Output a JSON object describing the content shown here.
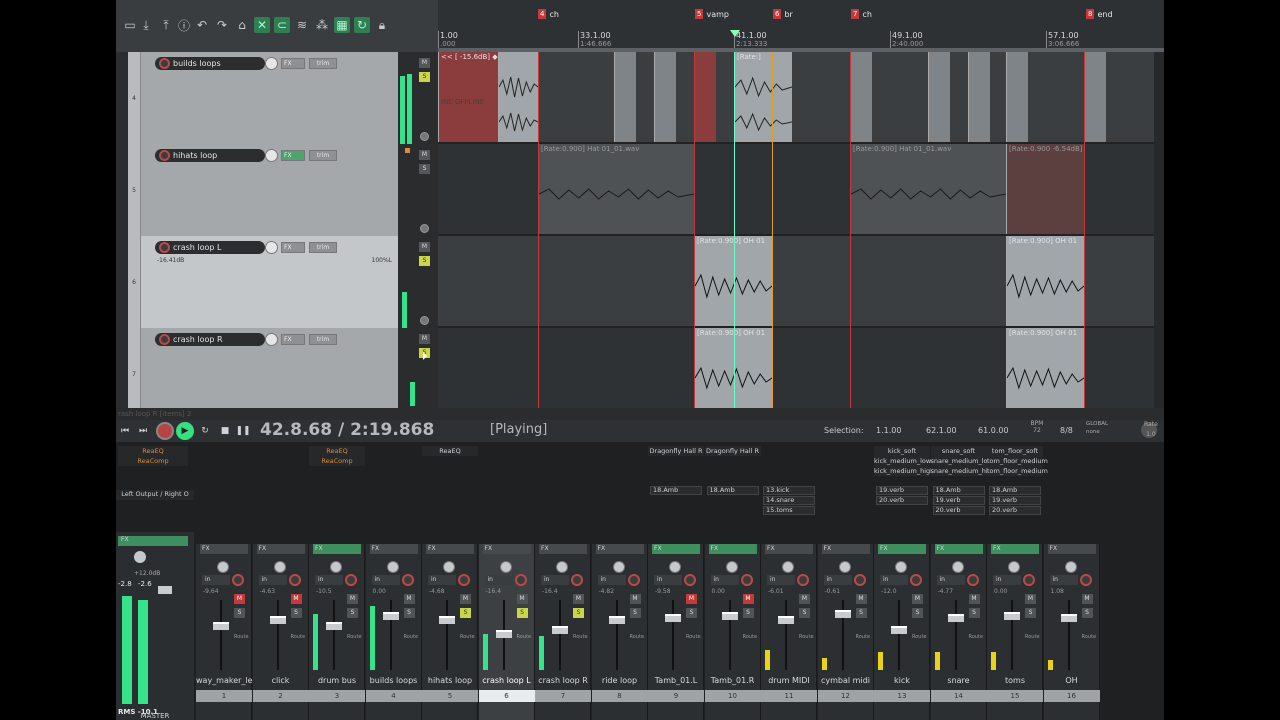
{
  "toolbar": {
    "icons": [
      "new-project-icon",
      "save-icon",
      "export-icon",
      "info-icon",
      "undo-icon",
      "redo-icon",
      "metronome-icon",
      "ripple-icon",
      "link-icon",
      "groups-icon",
      "grid-icon",
      "loop-icon",
      "lock-icon"
    ]
  },
  "ruler": {
    "labels": [
      {
        "bar": "1.00",
        "time": ".000"
      },
      {
        "bar": "33.1.00",
        "time": "1:46.666"
      },
      {
        "bar": "41.1.00",
        "time": "2:13.333"
      },
      {
        "bar": "49.1.00",
        "time": "2:40.000"
      },
      {
        "bar": "57.1.00",
        "time": "3:06.666"
      }
    ],
    "markers": [
      {
        "num": "4",
        "name": "ch"
      },
      {
        "num": "5",
        "name": "vamp"
      },
      {
        "num": "6",
        "name": "br"
      },
      {
        "num": "7",
        "name": "ch"
      },
      {
        "num": "8",
        "name": "end"
      }
    ]
  },
  "tracks": [
    {
      "num": "4",
      "name": "builds loops",
      "vol": "",
      "pan": "",
      "fx_on": false
    },
    {
      "num": "5",
      "name": "hihats loop",
      "vol": "",
      "pan": "",
      "fx_on": true
    },
    {
      "num": "6",
      "name": "crash loop L",
      "vol": "-16.41dB",
      "pan": "100%L",
      "fx_on": false
    },
    {
      "num": "7",
      "name": "crash loop R",
      "vol": "",
      "pan": "",
      "fx_on": false
    }
  ],
  "tcp_labels": {
    "fx": "FX",
    "trim": "trim",
    "mute": "M",
    "solo": "S"
  },
  "items": {
    "builds": [
      "<< [ -15.6dB] ◆ [Rate:]",
      "[Rate:]"
    ],
    "offline": "INE   OFFLINE",
    "hihats": [
      "[Rate:0.900] Hat 01_01.wav",
      "[Rate:0.900] Hat 01_01.wav",
      "[Rate:0.900 -6.54dB]"
    ],
    "crashL": [
      "[Rate:0.900] OH 01",
      "[Rate:0.900] OH 01"
    ],
    "crashR": [
      "[Rate:0.900] OH 01",
      "[Rate:0.900] OH 01"
    ],
    "marker_badge": "1"
  },
  "status_line": "rash loop R [items] 2",
  "transport": {
    "time": "42.8.68 / 2:19.868",
    "state": "[Playing]",
    "selection_label": "Selection:",
    "sel_start": "1.1.00",
    "sel_end": "62.1.00",
    "sel_len": "61.0.00",
    "bpm_label": "BPM",
    "bpm": "72",
    "sig": "8/8",
    "global_label": "GLOBAL",
    "global_val": "none",
    "rate_label": "Rate",
    "rate": "1.0"
  },
  "mixer": {
    "master_fx": [
      "ReaEQ",
      "ReaComp"
    ],
    "master_route": "Left Output / Right O",
    "strip_fx": [
      {
        "strip": 3,
        "lines": [
          "ReaEQ",
          "ReaComp"
        ]
      },
      {
        "strip": 5,
        "lines": [
          "ReaEQ"
        ]
      },
      {
        "strip": 9,
        "lines": [
          "Dragonfly Hall R"
        ]
      },
      {
        "strip": 10,
        "lines": [
          "Dragonfly Hall R"
        ]
      },
      {
        "strip": 13,
        "lines": [
          "kick_soft",
          "kick_medium_low",
          "kick_medium_high"
        ]
      },
      {
        "strip": 14,
        "lines": [
          "snare_soft",
          "snare_medium_low",
          "snare_medium_high"
        ]
      },
      {
        "strip": 15,
        "lines": [
          "tom_floor_soft",
          "tom_floor_medium",
          "tom_floor_medium"
        ]
      }
    ],
    "sends": [
      {
        "strip": 9,
        "lines": [
          "18.Amb"
        ]
      },
      {
        "strip": 10,
        "lines": [
          "18.Amb"
        ]
      },
      {
        "strip": 11,
        "lines": [
          "13.kick",
          "14.snare",
          "15.toms"
        ]
      },
      {
        "strip": 13,
        "lines": [
          "19.verb",
          "20.verb"
        ]
      },
      {
        "strip": 14,
        "lines": [
          "18.Amb",
          "19.verb",
          "20.verb"
        ]
      },
      {
        "strip": 15,
        "lines": [
          "18.Amb",
          "19.verb",
          "20.verb"
        ]
      }
    ],
    "master": {
      "label": "MASTER",
      "peak_l": "-2.8",
      "peak_r": "-2.6",
      "vol": "+12.0dB",
      "rms": "RMS -10.1"
    },
    "strips": [
      {
        "name": "way_maker_le",
        "num": "1",
        "db": "-9.64",
        "mute": true
      },
      {
        "name": "click",
        "num": "2",
        "db": "-4.63",
        "mute": true
      },
      {
        "name": "drum bus",
        "num": "3",
        "db": "-10.5",
        "mute": false
      },
      {
        "name": "builds loops",
        "num": "4",
        "db": "0.00",
        "mute": false
      },
      {
        "name": "hihats loop",
        "num": "5",
        "db": "-4.68",
        "mute": false,
        "solo": true
      },
      {
        "name": "crash loop L",
        "num": "6",
        "db": "-16.4",
        "mute": false,
        "solo": true,
        "sel": true
      },
      {
        "name": "crash loop R",
        "num": "7",
        "db": "-16.4",
        "mute": false,
        "solo": true
      },
      {
        "name": "ride loop",
        "num": "8",
        "db": "-4.82",
        "mute": false
      },
      {
        "name": "Tamb_01.L",
        "num": "9",
        "db": "-9.58",
        "mute": true
      },
      {
        "name": "Tamb_01.R",
        "num": "10",
        "db": "0.00",
        "mute": true
      },
      {
        "name": "drum MIDI",
        "num": "11",
        "db": "-6.01",
        "mute": false
      },
      {
        "name": "cymbal midi",
        "num": "12",
        "db": "-0.61",
        "mute": false
      },
      {
        "name": "kick",
        "num": "13",
        "db": "-12.0",
        "mute": false
      },
      {
        "name": "snare",
        "num": "14",
        "db": "-4.77",
        "mute": false
      },
      {
        "name": "toms",
        "num": "15",
        "db": "0.00",
        "mute": false
      },
      {
        "name": "OH",
        "num": "16",
        "db": "1.08",
        "mute": false
      }
    ],
    "labels": {
      "fx": "FX",
      "io": "in",
      "mute": "M",
      "solo": "S",
      "route": "Route",
      "trim": "trim"
    }
  },
  "colors": {
    "marker": "#c43a3a",
    "cursor": "#e39a2e",
    "meter": "#35e38a",
    "solo": "#c9d64a"
  }
}
